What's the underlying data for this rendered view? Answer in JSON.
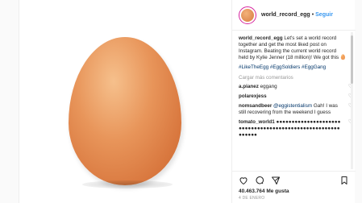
{
  "post": {
    "username": "world_record_egg",
    "follow_label": "Seguir",
    "dot": "•"
  },
  "caption": {
    "user": "world_record_egg",
    "text": " Let's set a world record together and get the most liked post on Instagram. Beating the current world record held by Kylie Jenner (18 million)! We got this 🥚",
    "hashtags": "#LikeTheEgg #EggSoldiers #EggGang"
  },
  "load_more": "Cargar más comentarios",
  "comments": [
    {
      "user": "a.pianez",
      "text": " eggang"
    },
    {
      "user": "polarexjess",
      "text": ""
    },
    {
      "user": "nomsandbeer",
      "mention": " @eggistentialism",
      "text": " Gah! I was still recovering from the weekend I guess"
    },
    {
      "user": "tomato_world1",
      "text": " ●●●●●●●●●●●●●●●●●●●●●●●●●●●●●●●●●●●●●●●●●●●●●●●●●●●●●●●●●●●●"
    }
  ],
  "likes": "40.463.764 Me gusta",
  "date": "4 DE ENERO",
  "icons": [
    "heart-icon",
    "comment-icon",
    "share-icon",
    "bookmark-icon"
  ],
  "colors": {
    "link": "#3897f0",
    "hashtag": "#003569",
    "egg": "#e8955a"
  }
}
